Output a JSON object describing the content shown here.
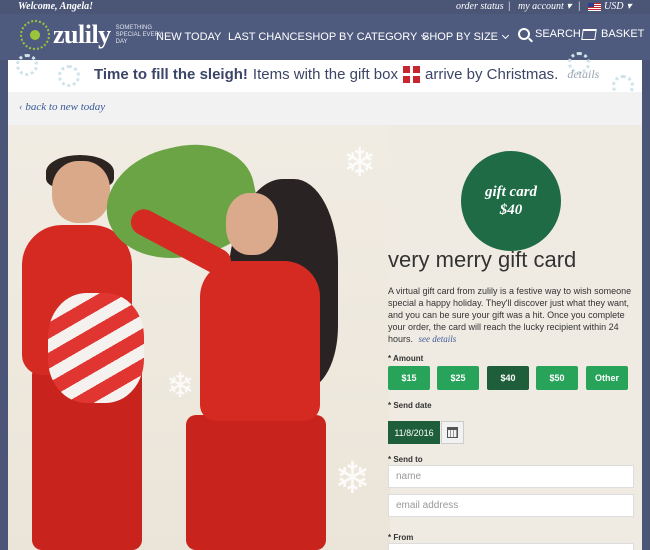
{
  "top_bar": {
    "welcome": "Welcome, Angela!",
    "order_status": "order status",
    "my_account": "my account",
    "currency": "USD"
  },
  "header": {
    "logo_text": "zulily",
    "logo_tagline": "SOMETHING SPECIAL EVERY DAY",
    "nav": [
      "NEW TODAY",
      "LAST CHANCE",
      "SHOP BY CATEGORY",
      "SHOP BY SIZE"
    ],
    "search_label": "SEARCH",
    "basket_label": "BASKET"
  },
  "promo": {
    "headline": "Time to fill the sleigh!",
    "text_before": "Items with the gift box",
    "text_after": "arrive by Christmas.",
    "details_link": "details"
  },
  "back_link": "back to new today",
  "product": {
    "badge_line1": "gift card",
    "badge_line2": "$40",
    "title": "very merry gift card",
    "description": "A virtual gift card from zulily is a festive way to wish someone special a happy holiday. They'll discover just what they want, and you can be sure your gift was a hit. Once you complete your order, the card will reach the lucky recipient within 24 hours.",
    "see_details": "see details",
    "amount_label": "* Amount",
    "amounts": [
      "$15",
      "$25",
      "$40",
      "$50",
      "Other"
    ],
    "selected_amount": "$40",
    "send_date_label": "* Send date",
    "send_date_value": "11/8/2016",
    "send_to_label": "* Send to",
    "name_placeholder": "name",
    "email_placeholder": "email address",
    "from_label": "* From"
  },
  "colors": {
    "header_bg": "#4f5b7e",
    "brand_green": "#1e6b45",
    "amount_green": "#27a35a",
    "selected_green": "#1e5e3a",
    "link_blue": "#3b5a9a"
  }
}
